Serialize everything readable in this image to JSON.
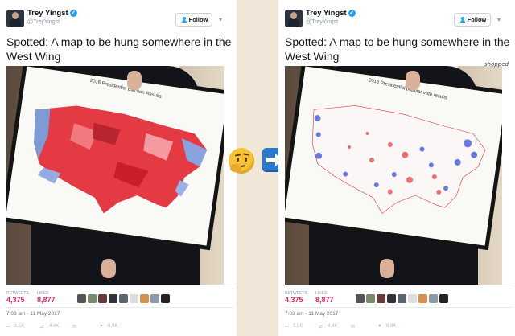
{
  "tweet_left": {
    "name": "Trey Yingst",
    "handle": "@TreyYingst",
    "follow_label": "Follow",
    "text": "Spotted: A map to be hung somewhere in the West Wing",
    "map_title": "2016 Presidential Election Results",
    "retweets_label": "RETWEETS",
    "retweets": "4,375",
    "likes_label": "LIKES",
    "likes": "8,877",
    "timestamp": "7:03 am - 11 May 2017",
    "reply_count": "1.5K",
    "retweet_count": "4.4K",
    "like_count": "8.9K"
  },
  "tweet_right": {
    "name": "Trey Yingst",
    "handle": "@TreyYingst",
    "follow_label": "Follow",
    "text": "Spotted: A map to be hung somewhere in the West Wing",
    "map_title": "2016 Presidential popular vote results",
    "watermark": "shopped",
    "retweets_label": "RETWEETS",
    "retweets": "4,375",
    "likes_label": "LIKES",
    "likes": "8,877",
    "timestamp": "7:03 am - 11 May 2017",
    "reply_count": "1.9K",
    "retweet_count": "4.4K",
    "like_count": "8.8K"
  },
  "icons": [
    "verified-icon",
    "follow-person-icon",
    "chevron-down-icon",
    "reply-icon",
    "retweet-icon",
    "heart-icon",
    "dm-icon",
    "thinking-face-emoji",
    "right-arrow-emoji"
  ],
  "colors": {
    "accent": "#1da1f2",
    "likes_red": "#e0245e",
    "map_red": "#e8343e",
    "map_blue": "#3b4fd6"
  }
}
